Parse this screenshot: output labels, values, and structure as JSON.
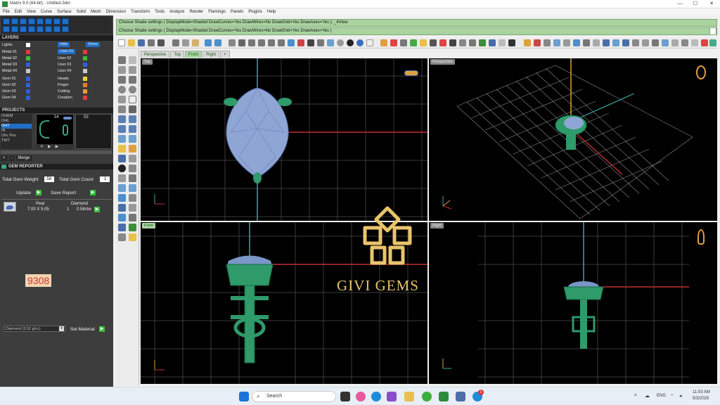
{
  "window": {
    "title": "Matrix 9.0 (64-bit) - Untitled.3dm",
    "min": "—",
    "max": "☐",
    "close": "✕"
  },
  "menu": [
    "File",
    "Edit",
    "View",
    "Curve",
    "Surface",
    "Solid",
    "Mesh",
    "Dimension",
    "Transform",
    "Tools",
    "Analyze",
    "Render",
    "Flamingo",
    "Panels",
    "Plugins",
    "Help"
  ],
  "layers": {
    "header": "LAYERS",
    "lights_label": "Lights",
    "hide_label": "Hide",
    "show_label": "Show",
    "rows": [
      {
        "metal": "Metal 01",
        "user": "User 01",
        "color": "#e23b3b"
      },
      {
        "metal": "Metal 02",
        "user": "User 02",
        "color": "#3cbc3c"
      },
      {
        "metal": "Metal 03",
        "user": "User 03",
        "color": "#2f5fd8"
      },
      {
        "metal": "Metal 04",
        "user": "User 04",
        "color": "#c8c8c8"
      }
    ],
    "gem_rows": [
      {
        "gem": "Gem 01",
        "group": "Heads",
        "color": "#e8d23a"
      },
      {
        "gem": "Gem 02",
        "group": "Finger",
        "color": "#e87a2a"
      },
      {
        "gem": "Gem 03",
        "group": "Cutting",
        "color": "#e89a3a"
      },
      {
        "gem": "Gem 04",
        "group": "Creation",
        "color": "#d94040"
      }
    ]
  },
  "projects": {
    "header": "PROJECTS",
    "items": [
      "OHEM",
      "OHL",
      "OHT",
      "IN",
      "Ohc Pss",
      "TWT"
    ],
    "thumb_nums": [
      "54",
      "55"
    ],
    "buttons": [
      "+",
      "-",
      "Merge"
    ]
  },
  "gem_reporter": {
    "header": "GEM REPORTER",
    "total_weight_label": "Total Gem Weight",
    "total_weight_value": ".58",
    "total_count_label": "Total Gem Count",
    "total_count_value": "1",
    "update_label": "Update",
    "save_label": "Save Report",
    "table_head": [
      "Pear",
      "Diamond"
    ],
    "row": {
      "size": "7.00 X 5.05",
      "qty": "1",
      "weight": "0.58ctw"
    },
    "badge": "9308",
    "material_value": "Diamond (3.52 g/cc)",
    "set_material_label": "Set Material"
  },
  "commands": [
    "Choose Shade settings ( DisplayMode=Shaded  DrawCurves=Yes  DrawWires=No  DrawGrid=Yes  DrawAxes=Yes ): _4View",
    "Choose Shade settings ( DisplayMode=Shaded  DrawCurves=Yes  DrawWires=No  DrawGrid=Yes  DrawAxes=Yes )"
  ],
  "viewport_tabs": [
    "Perspective",
    "Top",
    "Front",
    "Right"
  ],
  "viewports": {
    "top": "Top",
    "perspective": "Perspective",
    "front": "Front",
    "right": "Right"
  },
  "watermark": {
    "text": "GIVI GEMS"
  },
  "taskbar": {
    "search_placeholder": "Search",
    "lang": "ENG",
    "time": "11:03 AM",
    "date": "5/3/2025",
    "notif_count": "3"
  }
}
